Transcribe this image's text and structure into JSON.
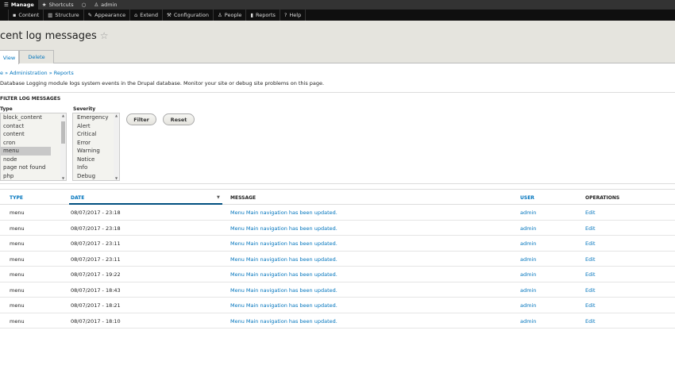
{
  "toolbar": {
    "manage": "Manage",
    "shortcuts": "Shortcuts",
    "user": "admin"
  },
  "menu": [
    "Content",
    "Structure",
    "Appearance",
    "Extend",
    "Configuration",
    "People",
    "Reports",
    "Help"
  ],
  "page": {
    "title": "cent log messages",
    "tabs": [
      "View",
      "Delete"
    ],
    "breadcrumb": "e » Administration » Reports",
    "description": "Database Logging module logs system events in the Drupal database. Monitor your site or debug site problems on this page."
  },
  "filter": {
    "heading": "FILTER LOG MESSAGES",
    "type_label": "Type",
    "type_options": [
      "block_content",
      "contact",
      "content",
      "cron",
      "menu",
      "node",
      "page not found",
      "php"
    ],
    "type_selected": "menu",
    "severity_label": "Severity",
    "severity_options": [
      "Emergency",
      "Alert",
      "Critical",
      "Error",
      "Warning",
      "Notice",
      "Info",
      "Debug"
    ],
    "filter_btn": "Filter",
    "reset_btn": "Reset"
  },
  "table": {
    "headers": [
      "TYPE",
      "DATE",
      "MESSAGE",
      "USER",
      "OPERATIONS"
    ],
    "rows": [
      [
        "menu",
        "08/07/2017 - 23:18",
        "Menu Main navigation has been updated.",
        "admin",
        "Edit"
      ],
      [
        "menu",
        "08/07/2017 - 23:18",
        "Menu Main navigation has been updated.",
        "admin",
        "Edit"
      ],
      [
        "menu",
        "08/07/2017 - 23:11",
        "Menu Main navigation has been updated.",
        "admin",
        "Edit"
      ],
      [
        "menu",
        "08/07/2017 - 23:11",
        "Menu Main navigation has been updated.",
        "admin",
        "Edit"
      ],
      [
        "menu",
        "08/07/2017 - 19:22",
        "Menu Main navigation has been updated.",
        "admin",
        "Edit"
      ],
      [
        "menu",
        "08/07/2017 - 18:43",
        "Menu Main navigation has been updated.",
        "admin",
        "Edit"
      ],
      [
        "menu",
        "08/07/2017 - 18:21",
        "Menu Main navigation has been updated.",
        "admin",
        "Edit"
      ],
      [
        "menu",
        "08/07/2017 - 18:10",
        "Menu Main navigation has been updated.",
        "admin",
        "Edit"
      ]
    ]
  }
}
